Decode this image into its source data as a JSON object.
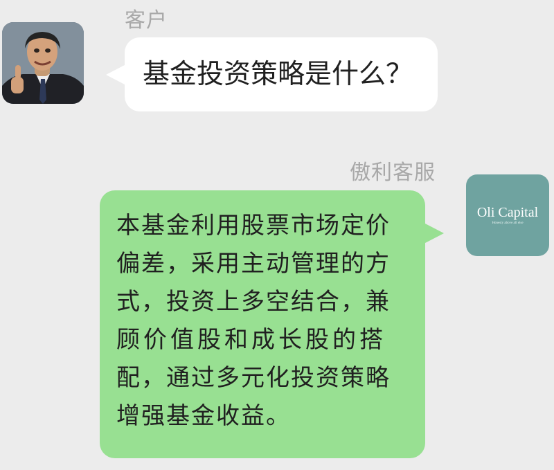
{
  "messages": {
    "customer": {
      "sender": "客户",
      "avatar_icon": "person-thumbs-up-photo",
      "text": "基金投资策略是什么？"
    },
    "agent": {
      "sender": "傲利客服",
      "avatar": {
        "logo_text": "Oli Capital",
        "tagline": "Honesty above all else"
      },
      "lines": [
        "本基金利用股票市场定价",
        "偏差，采用主动管理的方",
        "式，投资上多空结合，兼",
        "顾价值股和成长股的搭",
        "配，通过多元化投资策略",
        "增强基金收益。"
      ]
    }
  },
  "colors": {
    "background": "#ececec",
    "customer_bubble": "#ffffff",
    "agent_bubble": "#98e092",
    "agent_avatar": "#6fa3a0",
    "sender_name": "#a8a8a8"
  }
}
